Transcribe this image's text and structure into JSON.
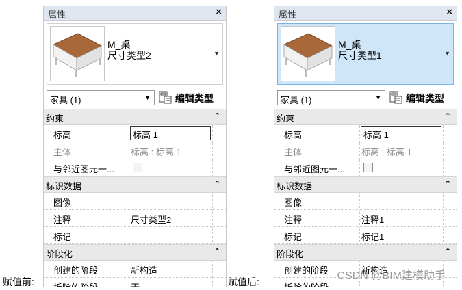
{
  "captions": {
    "before": "赋值前:",
    "after": "赋值后:"
  },
  "panels": [
    {
      "title": "属性",
      "close": "×",
      "type_family": "M_桌",
      "type_name": "尺寸类型2",
      "category": "家具 (1)",
      "edit_type": "编辑类型",
      "sections": [
        {
          "title": "约束",
          "rows": [
            {
              "key": "标高",
              "value": "标高 1"
            },
            {
              "key": "主体",
              "value": "标高 : 标高 1"
            },
            {
              "key": "与邻近图元一...",
              "value": ""
            }
          ]
        },
        {
          "title": "标识数据",
          "rows": [
            {
              "key": "图像",
              "value": ""
            },
            {
              "key": "注释",
              "value": "尺寸类型2"
            },
            {
              "key": "标记",
              "value": ""
            }
          ]
        },
        {
          "title": "阶段化",
          "rows": [
            {
              "key": "创建的阶段",
              "value": "新构造"
            },
            {
              "key": "拆除的阶段",
              "value": "无"
            }
          ]
        }
      ]
    },
    {
      "title": "属性",
      "close": "×",
      "type_family": "M_桌",
      "type_name": "尺寸类型1",
      "category": "家具 (1)",
      "edit_type": "编辑类型",
      "sections": [
        {
          "title": "约束",
          "rows": [
            {
              "key": "标高",
              "value": "标高 1"
            },
            {
              "key": "主体",
              "value": "标高 : 标高 1"
            },
            {
              "key": "与邻近图元一...",
              "value": ""
            }
          ]
        },
        {
          "title": "标识数据",
          "rows": [
            {
              "key": "图像",
              "value": ""
            },
            {
              "key": "注释",
              "value": "注释1"
            },
            {
              "key": "标记",
              "value": "标记1"
            }
          ]
        },
        {
          "title": "阶段化",
          "rows": [
            {
              "key": "创建的阶段",
              "value": "新构造"
            },
            {
              "key": "拆除的阶段",
              "value": ""
            }
          ]
        }
      ]
    }
  ],
  "watermark": "CSDN @BIM建模助手",
  "colors": {
    "selected_type_bg": "#cfe6f8",
    "titlebar": "#dfe6ef",
    "section_bg": "#e9e9e9",
    "table_top": "#a8683a"
  }
}
